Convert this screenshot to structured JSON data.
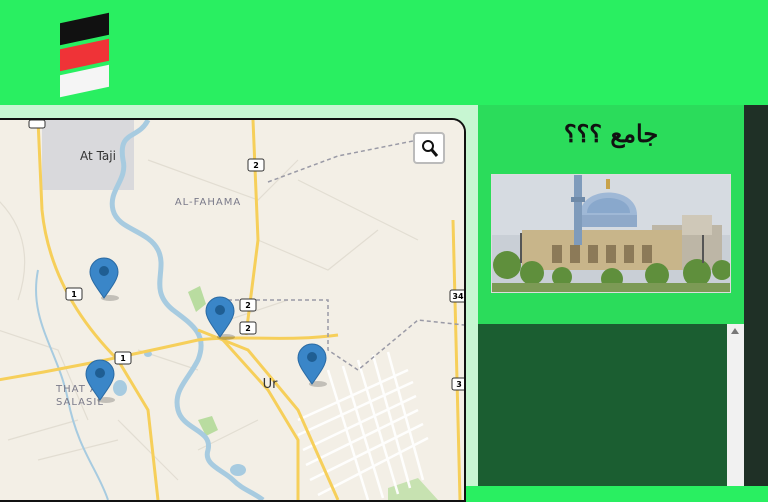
{
  "logo": {
    "colors": [
      "#111111",
      "#ef3337",
      "#f5f5f5"
    ]
  },
  "map": {
    "place_labels": {
      "at_taji": "At Taji",
      "al_fahama": "AL-FAHAMA",
      "ur": "Ur",
      "that_as_line1": "THAT A",
      "that_as_line2": "SALASIL"
    },
    "road_shields": [
      "1",
      "2",
      "2",
      "2",
      "1",
      "1",
      "34",
      "3"
    ],
    "markers_count": 4,
    "marker_color": "#3a86c8",
    "search_icon": "magnifier-icon"
  },
  "panel": {
    "title": "جامع ؟؟؟",
    "photo_icon": "mosque-photo"
  },
  "colors": {
    "header_bg": "#29ef61",
    "panel_bg": "#2bdc5b",
    "dark_panel_bg": "#1b5e31"
  }
}
